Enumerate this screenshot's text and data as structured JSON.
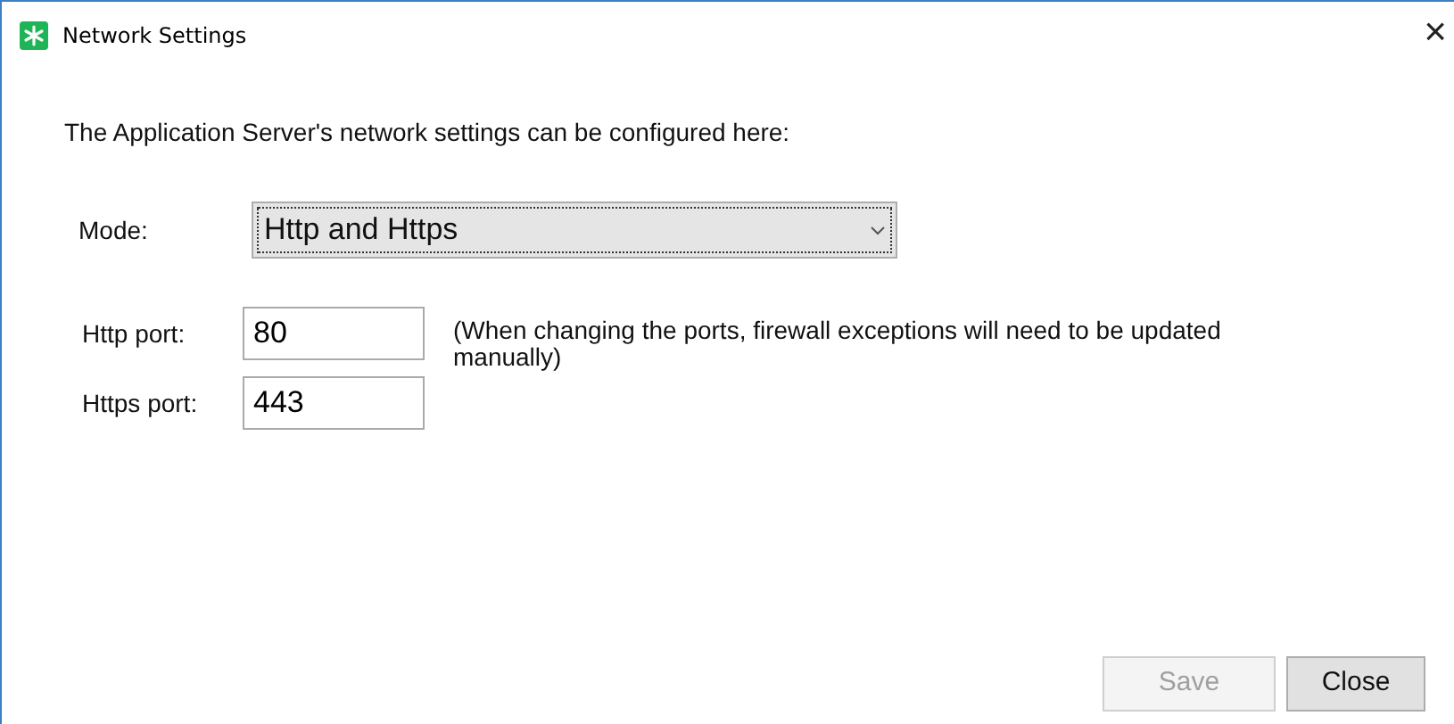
{
  "window": {
    "title": "Network Settings",
    "close": "×"
  },
  "intro": "The Application Server's network settings can be configured here:",
  "mode": {
    "label": "Mode:",
    "value": "Http and Https"
  },
  "ports": [
    {
      "label": "Http port:",
      "value": "80"
    },
    {
      "label": "Https port:",
      "value": "443"
    }
  ],
  "note": "(When changing the ports, firewall exceptions will need to be updated manually)",
  "buttons": [
    {
      "label": "Save",
      "disabled": true
    },
    {
      "label": "Close",
      "disabled": false
    }
  ]
}
